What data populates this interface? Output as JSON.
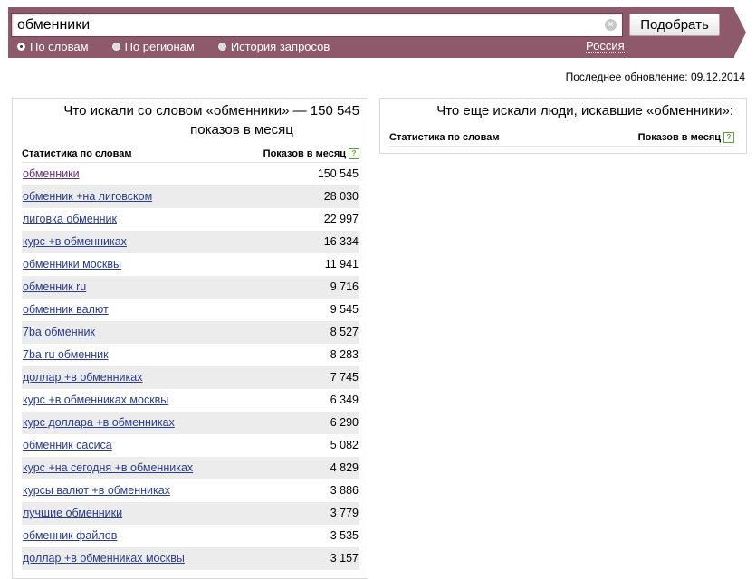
{
  "search": {
    "query": "обменники",
    "button_label": "Подобрать",
    "clear_symbol": "×"
  },
  "modes": [
    {
      "label": "По словам",
      "checked": true
    },
    {
      "label": "По регионам",
      "checked": false
    },
    {
      "label": "История запросов",
      "checked": false
    }
  ],
  "region": "Россия",
  "last_update": "Последнее обновление: 09.12.2014",
  "left_panel": {
    "title_line1": "Что искали со словом «обменники» — 150 545",
    "title_line2": "показов в месяц",
    "col_words": "Статистика по словам",
    "col_shows": "Показов в месяц",
    "help": "?",
    "rows": [
      {
        "keyword": "обменники",
        "count": "150 545"
      },
      {
        "keyword": "обменник +на лиговском",
        "count": "28 030"
      },
      {
        "keyword": "лиговка обменник",
        "count": "22 997"
      },
      {
        "keyword": "курс +в обменниках",
        "count": "16 334"
      },
      {
        "keyword": "обменники москвы",
        "count": "11 941"
      },
      {
        "keyword": "обменник ru",
        "count": "9 716"
      },
      {
        "keyword": "обменник валют",
        "count": "9 545"
      },
      {
        "keyword": "7ba обменник",
        "count": "8 527"
      },
      {
        "keyword": "7ba ru обменник",
        "count": "8 283"
      },
      {
        "keyword": "доллар +в обменниках",
        "count": "7 745"
      },
      {
        "keyword": "курс +в обменниках москвы",
        "count": "6 349"
      },
      {
        "keyword": "курс доллара +в обменниках",
        "count": "6 290"
      },
      {
        "keyword": "обменник сасиса",
        "count": "5 082"
      },
      {
        "keyword": "курс +на сегодня +в обменниках",
        "count": "4 829"
      },
      {
        "keyword": "курсы валют +в обменниках",
        "count": "3 886"
      },
      {
        "keyword": "лучшие обменники",
        "count": "3 779"
      },
      {
        "keyword": "обменник файлов",
        "count": "3 535"
      },
      {
        "keyword": "доллар +в обменниках москвы",
        "count": "3 157"
      }
    ]
  },
  "right_panel": {
    "title": "Что еще искали люди, искавшие «обменники»:",
    "col_words": "Статистика по словам",
    "col_shows": "Показов в месяц",
    "help": "?"
  }
}
